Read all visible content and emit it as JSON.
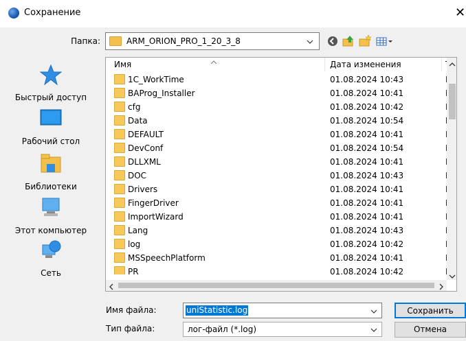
{
  "window": {
    "title": "Сохранение",
    "close_label": "✕"
  },
  "folder_bar": {
    "label": "Папка:",
    "current_folder": "ARM_ORION_PRO_1_20_3_8"
  },
  "places": [
    {
      "label": "Быстрый доступ",
      "icon": "star-icon"
    },
    {
      "label": "Рабочий стол",
      "icon": "desktop-icon"
    },
    {
      "label": "Библиотеки",
      "icon": "libraries-icon"
    },
    {
      "label": "Этот компьютер",
      "icon": "computer-icon"
    },
    {
      "label": "Сеть",
      "icon": "network-icon"
    }
  ],
  "file_list": {
    "columns": {
      "name": "Имя",
      "date": "Дата изменения",
      "type": "Ти"
    },
    "rows": [
      {
        "name": "1C_WorkTime",
        "date": "01.08.2024 10:43",
        "type": "Па"
      },
      {
        "name": "BAProg_Installer",
        "date": "01.08.2024 10:41",
        "type": "Па"
      },
      {
        "name": "cfg",
        "date": "01.08.2024 10:42",
        "type": "Па"
      },
      {
        "name": "Data",
        "date": "01.08.2024 10:54",
        "type": "Па"
      },
      {
        "name": "DEFAULT",
        "date": "01.08.2024 10:41",
        "type": "Па"
      },
      {
        "name": "DevConf",
        "date": "01.08.2024 10:54",
        "type": "Па"
      },
      {
        "name": "DLLXML",
        "date": "01.08.2024 10:41",
        "type": "Па"
      },
      {
        "name": "DOC",
        "date": "01.08.2024 10:43",
        "type": "Па"
      },
      {
        "name": "Drivers",
        "date": "01.08.2024 10:41",
        "type": "Па"
      },
      {
        "name": "FingerDriver",
        "date": "01.08.2024 10:41",
        "type": "Па"
      },
      {
        "name": "ImportWizard",
        "date": "01.08.2024 10:41",
        "type": "Па"
      },
      {
        "name": "Lang",
        "date": "01.08.2024 10:43",
        "type": "Па"
      },
      {
        "name": "log",
        "date": "01.08.2024 10:42",
        "type": "Па"
      },
      {
        "name": "MSSpeechPlatform",
        "date": "01.08.2024 10:41",
        "type": "Па"
      },
      {
        "name": "PR",
        "date": "01.08.2024 10:42",
        "type": "Па"
      }
    ]
  },
  "bottom": {
    "filename_label": "Имя файла:",
    "filename_value": "uniStatistic.log",
    "filetype_label": "Тип файла:",
    "filetype_value": "лог-файл (*.log)",
    "save_label": "Сохранить",
    "cancel_label": "Отмена"
  },
  "colors": {
    "accent": "#0078d7",
    "folder": "#f6c95a"
  }
}
